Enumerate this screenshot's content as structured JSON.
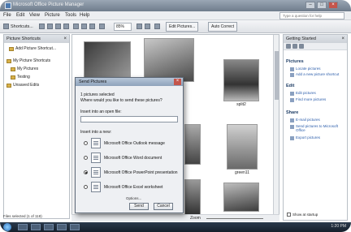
{
  "window": {
    "title": "Microsoft Office Picture Manager"
  },
  "menu": [
    "File",
    "Edit",
    "View",
    "Picture",
    "Tools",
    "Help"
  ],
  "help_search": {
    "placeholder": "Type a question for help"
  },
  "toolbar": {
    "shortcuts_label": "Shortcuts...",
    "zoom_value": "85%",
    "edit_pictures_label": "Edit Pictures...",
    "auto_correct_label": "Auto Correct"
  },
  "left_pane": {
    "title": "Picture Shortcuts",
    "add_shortcut": "Add Picture Shortcut...",
    "tree": [
      "My Picture Shortcuts",
      "My Pictures",
      "Testing",
      "Unsaved Edits"
    ],
    "status": "Files selected (1 of 118)"
  },
  "thumbnails": {
    "labels": [
      "split2",
      "green11"
    ]
  },
  "zoom_label": "Zoom",
  "right_pane": {
    "title": "Getting Started",
    "sections": {
      "picture_title": "Pictures",
      "picture_links": [
        "Locate pictures",
        "Add a new picture shortcut"
      ],
      "edit_title": "Edit",
      "edit_links": [
        "Edit pictures",
        "Find more pictures"
      ],
      "share_title": "Share",
      "share_links": [
        "E-mail pictures",
        "Send pictures to Microsoft Office",
        "Export pictures"
      ]
    },
    "show_at_startup": "Show at startup"
  },
  "dialog": {
    "title": "Send Pictures",
    "line1": "1 pictures selected",
    "line2": "Where would you like to send these pictures?",
    "open_file_label": "Insert into an open file:",
    "new_file_label": "Insert into a new:",
    "options": [
      "Microsoft Office Outlook message",
      "Microsoft Office Word document",
      "Microsoft Office PowerPoint presentation",
      "Microsoft Office Excel worksheet"
    ],
    "selected_option": 2,
    "options_link": "Options...",
    "send_button": "Send",
    "cancel_button": "Cancel"
  },
  "taskbar": {
    "clock": "1:20 PM"
  }
}
